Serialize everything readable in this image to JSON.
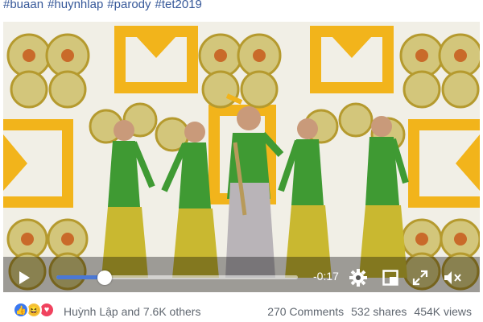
{
  "post": {
    "hashtags": [
      "#buaan",
      "#huynhlap",
      "#parody",
      "#tet2019"
    ]
  },
  "video": {
    "time_remaining": "-0:17",
    "progress": 0.2,
    "colors": {
      "background": "#f1efe6",
      "yellow": "#f2b41b",
      "pattern": "#b59a2e",
      "dress_top": "#3f9a33",
      "dress_skirt": "#c9b830",
      "accent_blue": "#4b78d4"
    }
  },
  "reactions": {
    "icons": [
      "like-icon",
      "haha-icon",
      "love-icon"
    ],
    "summary": "Huỳnh Lập and 7.6K others"
  },
  "stats": {
    "comments": "270 Comments",
    "shares": "532 shares",
    "views": "454K views"
  }
}
